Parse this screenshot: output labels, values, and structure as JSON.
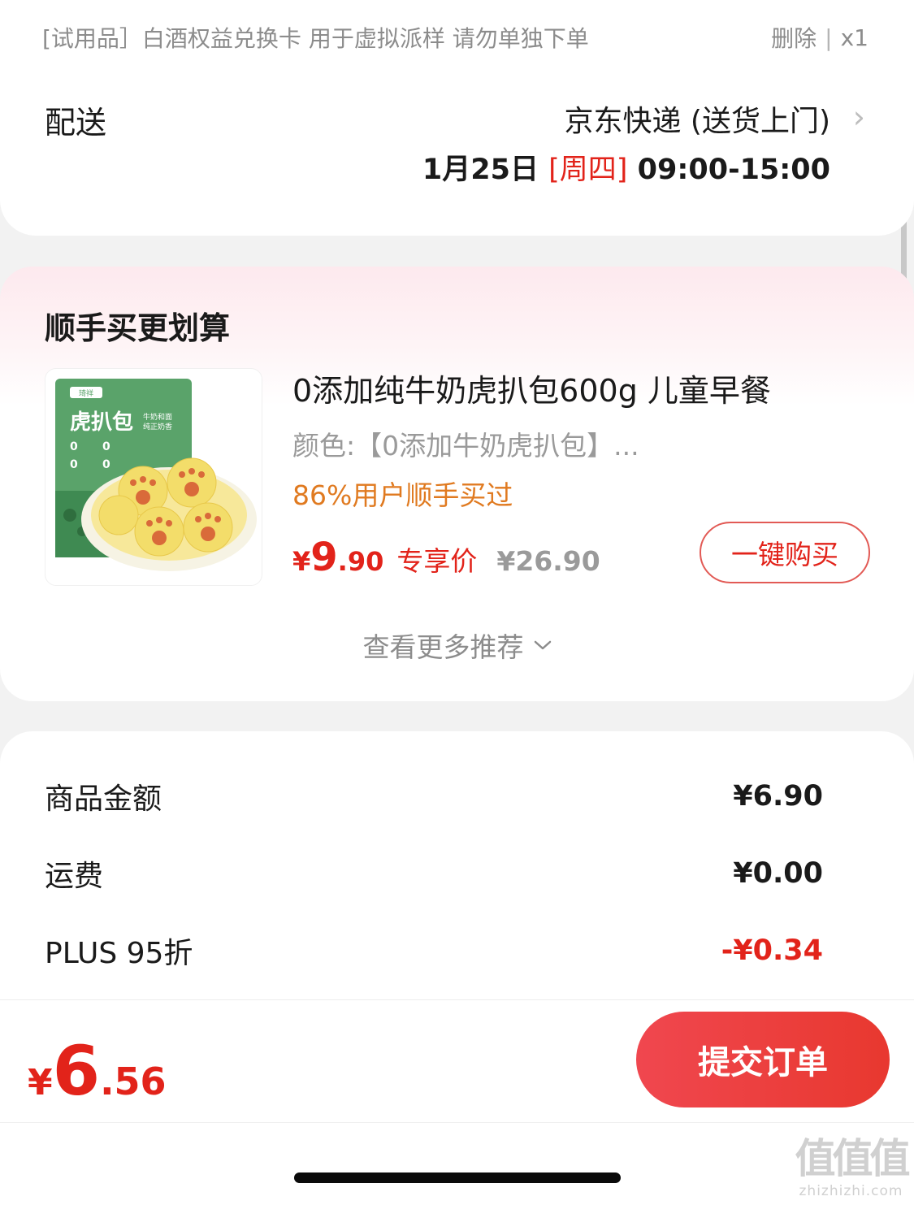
{
  "trial_item": {
    "title": "[试用品］白酒权益兑换卡 用于虚拟派样 请勿单独下单",
    "delete_label": "删除",
    "divider": "|",
    "quantity": "x1"
  },
  "delivery": {
    "label": "配送",
    "method": "京东快递 (送货上门)",
    "date": "1月25日",
    "weekday": "[周四]",
    "time_range": "09:00-15:00"
  },
  "recommend": {
    "title": "顺手买更划算",
    "product": {
      "image_brand": "琦祥",
      "image_title": "虎扒包",
      "image_sub1": "牛奶和面",
      "image_sub2": "纯正奶香",
      "name": "0添加纯牛奶虎扒包600g 儿童早餐",
      "spec": "颜色:【0添加牛奶虎扒包】...",
      "popularity": "86%用户顺手买过",
      "price_symbol": "¥",
      "price_int": "9",
      "price_dec": ".90",
      "price_tag": "专享价",
      "original_price": "¥26.90",
      "buy_button": "一键购买"
    },
    "more_label": "查看更多推荐"
  },
  "summary": {
    "rows": [
      {
        "label": "商品金额",
        "value": "¥6.90"
      },
      {
        "label": "运费",
        "value": "¥0.00"
      },
      {
        "label": "PLUS 95折",
        "value": "-¥0.34"
      }
    ]
  },
  "bottom_bar": {
    "total_symbol": "¥",
    "total_int": "6",
    "total_dec": ".56",
    "submit_label": "提交订单"
  },
  "watermark": {
    "main": "值值值",
    "sub": "zhizhizhi.com"
  },
  "colors": {
    "accent_red": "#e2231a",
    "popularity_orange": "#e07a20",
    "text_gray": "#8c8c8c"
  }
}
